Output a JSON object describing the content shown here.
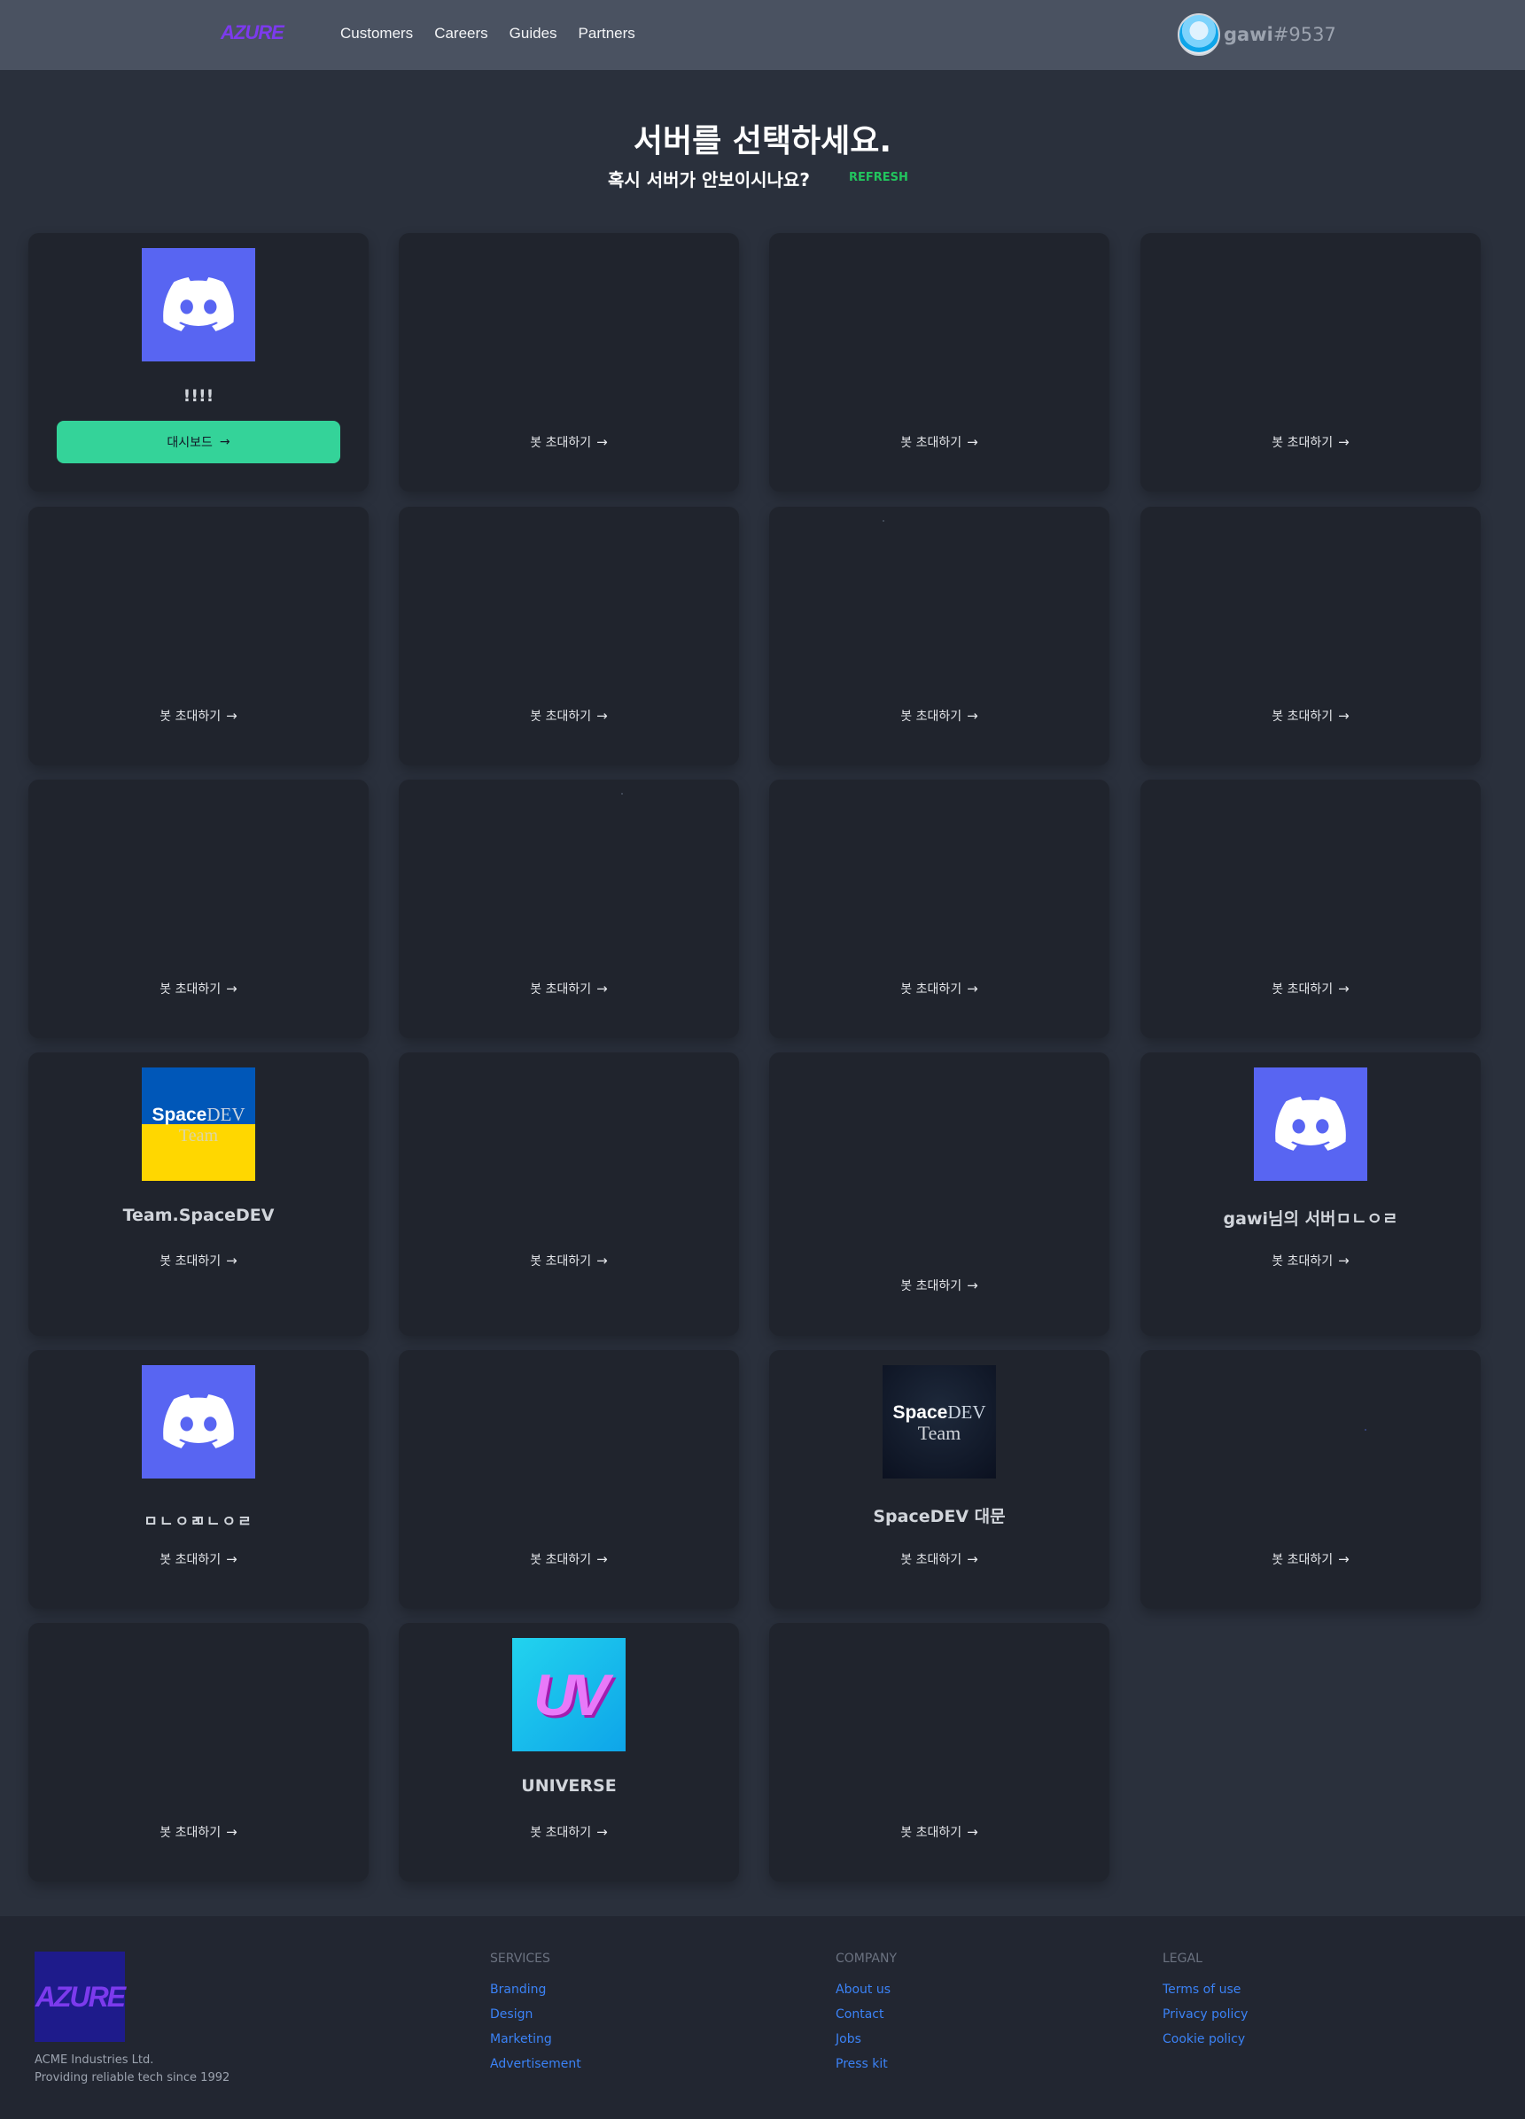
{
  "nav": {
    "logo": "AZURE",
    "links": [
      "Customers",
      "Careers",
      "Guides",
      "Partners"
    ],
    "user": {
      "name": "gawi",
      "tag": "#9537"
    }
  },
  "header": {
    "title": "서버를 선택하세요.",
    "subtitle": "혹시 서버가 안보이시나요?",
    "refresh": "REFRESH"
  },
  "servers": {
    "invite_label": "봇 초대하기",
    "dashboard_label": "대시보드",
    "arrow": "→",
    "c1_name": "!!!!",
    "c13_name": "Team.SpaceDEV",
    "c16_name": "gawi님의 서버ㅁㄴㅇㄹ",
    "c17_name": "ㅁㄴㅇㄻㄴㅇㄹ",
    "c19_name": "SpaceDEV 대문",
    "c22_name": "UNIVERSE",
    "spacedev_icon_word1": "Space",
    "spacedev_icon_word2": "DEV",
    "spacedev_icon_word3": "Team",
    "universe_icon_text": "UV"
  },
  "footer": {
    "logo": "AZURE",
    "company_line1": "ACME Industries Ltd.",
    "company_line2": "Providing reliable tech since 1992",
    "services": {
      "heading": "SERVICES",
      "links": [
        "Branding",
        "Design",
        "Marketing",
        "Advertisement"
      ]
    },
    "company": {
      "heading": "COMPANY",
      "links": [
        "About us",
        "Contact",
        "Jobs",
        "Press kit"
      ]
    },
    "legal": {
      "heading": "LEGAL",
      "links": [
        "Terms of use",
        "Privacy policy",
        "Cookie policy"
      ]
    }
  },
  "colors": {
    "accent_green": "#34d399",
    "refresh_green": "#22c55e",
    "discord_blurple": "#5865f2",
    "link_blue": "#3b82f6",
    "logo_purple": "#7c3aed"
  }
}
